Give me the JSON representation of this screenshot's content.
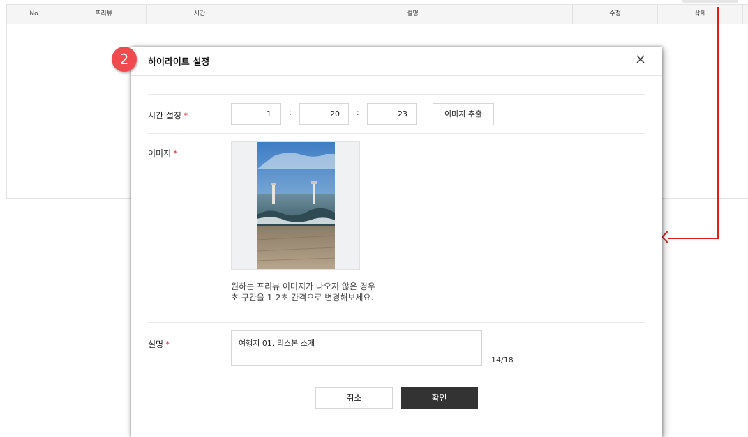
{
  "table": {
    "columns": [
      "No",
      "프리뷰",
      "시간",
      "설명",
      "수정",
      "삭제"
    ]
  },
  "step_badge": "2",
  "modal": {
    "title": "하이라이트 설정",
    "time_label": "시간 설정",
    "required_mark": "*",
    "time": {
      "hours": "1",
      "minutes": "20",
      "seconds": "23",
      "separator": ":"
    },
    "extract_button": "이미지 추출",
    "image_label": "이미지",
    "helper_line1": "원하는 프리뷰 이미지가 나오지 않은 경우",
    "helper_line2": "초 구간을 1-2초 간격으로 변경해보세요.",
    "description_label": "설명",
    "description_value": "여행지 01. 리스본 소개",
    "char_counter": "14/18",
    "cancel_button": "취소",
    "confirm_button": "확인"
  },
  "colors": {
    "badge": "#f04a4f",
    "required": "#e0303a",
    "connector": "#e01e1e",
    "confirm_button": "#333333"
  }
}
